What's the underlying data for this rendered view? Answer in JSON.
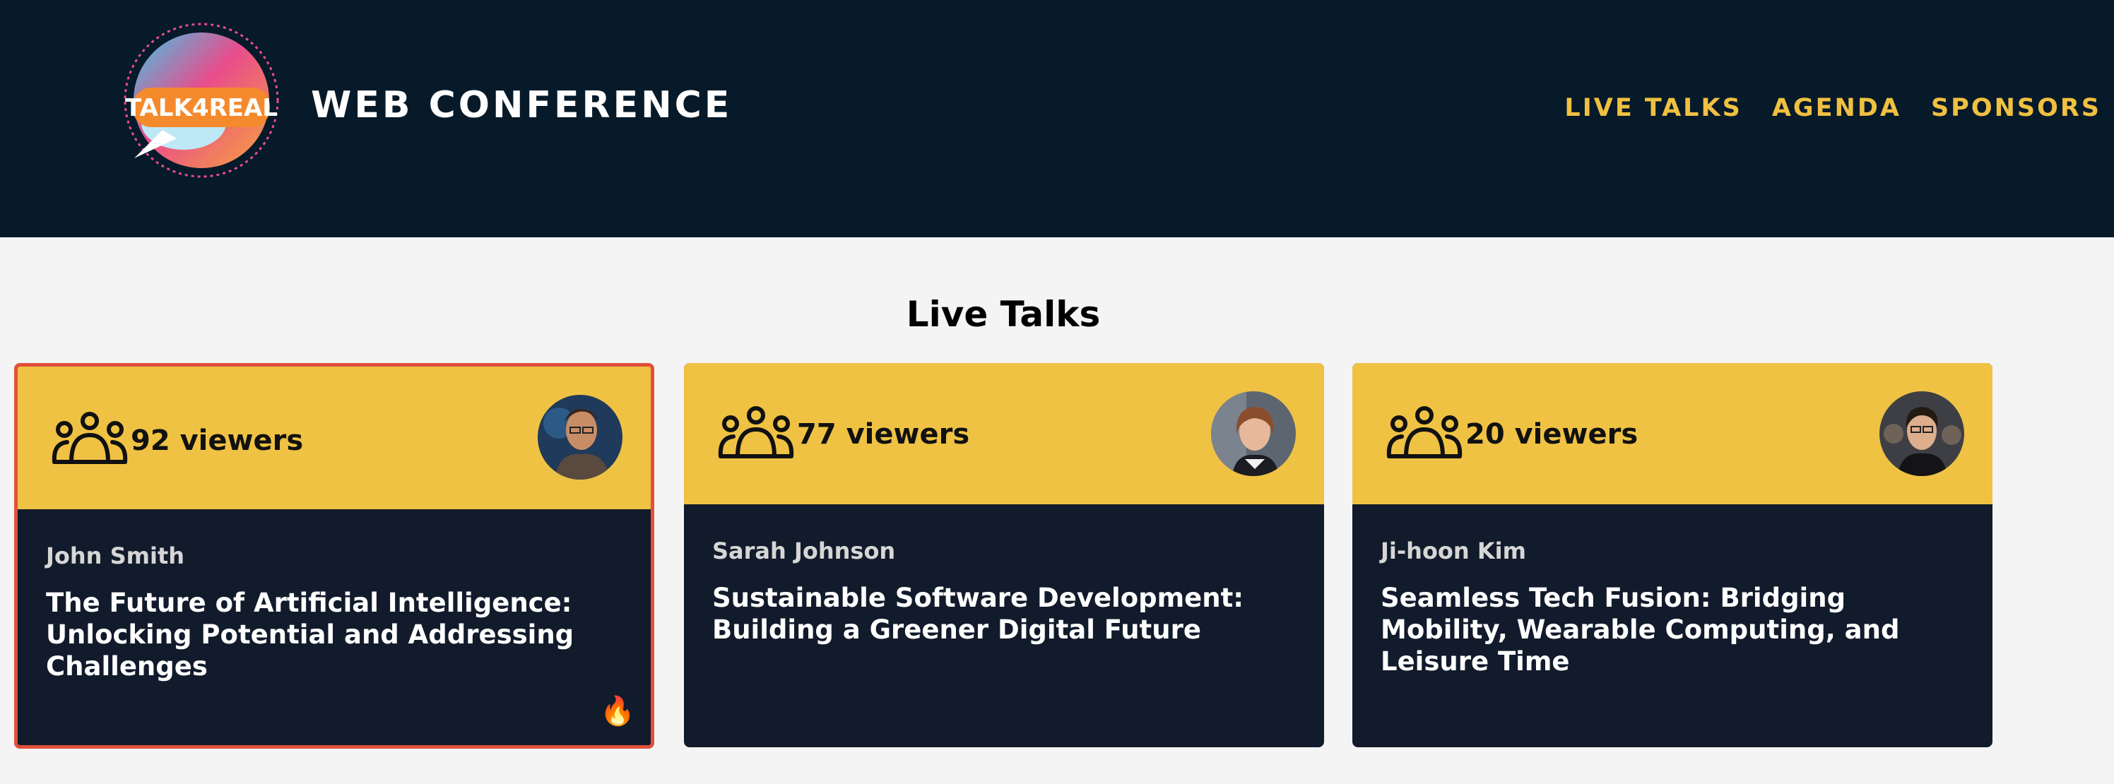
{
  "header": {
    "logo_text": "TALK4REAL",
    "site_title": "WEB CONFERENCE",
    "nav": [
      "LIVE TALKS",
      "AGENDA",
      "SPONSORS"
    ]
  },
  "main": {
    "section_title": "Live Talks",
    "cards": [
      {
        "viewers": "92 viewers",
        "speaker": "John Smith",
        "title": "The Future of Artificial Intelligence: Unlocking Potential and Addressing Challenges",
        "hot": true,
        "icon": "fire-icon"
      },
      {
        "viewers": "77 viewers",
        "speaker": "Sarah Johnson",
        "title": "Sustainable Software Development: Building a Greener Digital Future",
        "hot": false
      },
      {
        "viewers": "20 viewers",
        "speaker": "Ji-hoon Kim",
        "title": "Seamless Tech Fusion: Bridging Mobility, Wearable Computing, and Leisure Time",
        "hot": false
      }
    ]
  },
  "colors": {
    "header_bg": "#071a29",
    "accent": "#f0c040",
    "card_top": "#efc244",
    "card_bg": "#111b2b",
    "active_border": "#e2503a"
  }
}
